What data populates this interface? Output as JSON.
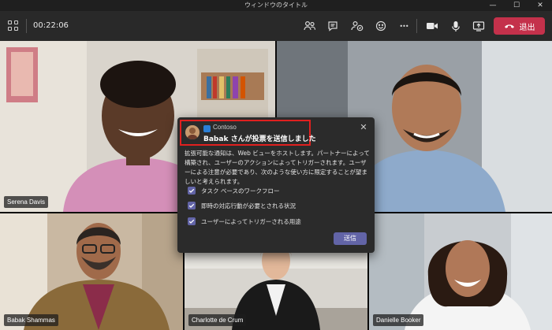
{
  "window": {
    "title": "ウィンドウのタイトル",
    "minimize_glyph": "—",
    "maximize_glyph": "☐",
    "close_glyph": "✕"
  },
  "toolbar": {
    "timer": "00:22:06",
    "leave_label": "退出",
    "more_glyph": "•••",
    "leave_color": "#c4314b",
    "icons": [
      "grid-view-icon",
      "participants-icon",
      "chat-icon",
      "raise-hand-icon",
      "reactions-icon",
      "more-options-icon",
      "camera-icon",
      "microphone-icon",
      "share-screen-icon",
      "hang-up-icon"
    ]
  },
  "participants": [
    {
      "name": "Serena Davis"
    },
    {
      "name": "Babak Shammas"
    },
    {
      "name": "Charlotte de Crum"
    },
    {
      "name": "Danielle Booker"
    }
  ],
  "notification": {
    "app_name": "Contoso",
    "title": "Babak さんが投票を送信しました",
    "body": "拡張可能な通知は、Web ビューをホストします。パートナーによって構築され、ユーザーのアクションによってトリガーされます。ユーザーによる注意が必要であり、次のような使い方に限定することが望ましいと考えられます。",
    "items": [
      "タスク ベースのワークフロー",
      "即時の対応行動が必要とされる状況",
      "ユーザーによってトリガーされる用途"
    ],
    "send_label": "送信",
    "close_glyph": "✕",
    "accent": "#6264a7",
    "highlight": "#e0201f"
  }
}
